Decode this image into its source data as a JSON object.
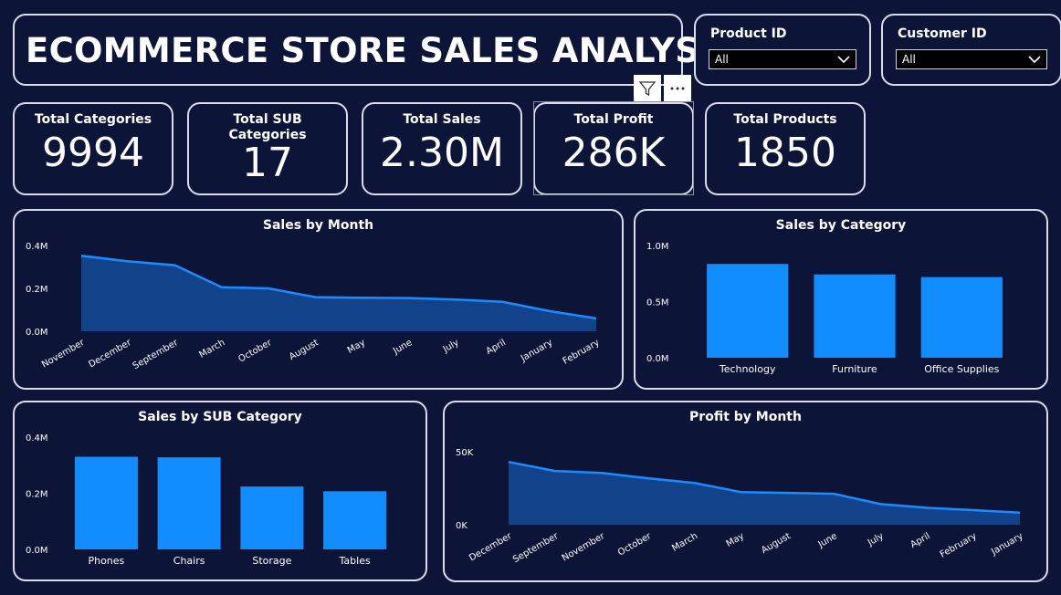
{
  "title": "ECOMMERCE STORE SALES ANALYSIS",
  "slicers": [
    {
      "label": "Product ID",
      "value": "All"
    },
    {
      "label": "Customer ID",
      "value": "All"
    }
  ],
  "kpis": [
    {
      "label": "Total Categories",
      "value": "9994"
    },
    {
      "label": "Total SUB Categories",
      "value": "17"
    },
    {
      "label": "Total Sales",
      "value": "2.30M"
    },
    {
      "label": "Total Profit",
      "value": "286K"
    },
    {
      "label": "Total Products",
      "value": "1850"
    }
  ],
  "toolbar": {
    "filter_icon": "filter-icon",
    "more_icon": "more-options-icon"
  },
  "colors": {
    "background": "#0c1538",
    "bar": "#118dff",
    "area_line": "#1a8cff",
    "area_fill": "#12438a",
    "border": "#d9dcea"
  },
  "chart_data": [
    {
      "type": "area",
      "title": "Sales by Month",
      "categories": [
        "November",
        "December",
        "September",
        "March",
        "October",
        "August",
        "May",
        "June",
        "July",
        "April",
        "January",
        "February"
      ],
      "values": [
        352000,
        326000,
        308000,
        205000,
        200000,
        159000,
        156000,
        155000,
        148000,
        137000,
        94000,
        60000
      ],
      "yticks": [
        "0.0M",
        "0.2M",
        "0.4M"
      ],
      "ylim": [
        0,
        400000
      ]
    },
    {
      "type": "bar",
      "title": "Sales by Category",
      "categories": [
        "Technology",
        "Furniture",
        "Office Supplies"
      ],
      "values": [
        836000,
        742000,
        719000
      ],
      "yticks": [
        "0.0M",
        "0.5M",
        "1.0M"
      ],
      "ylim": [
        0,
        1000000
      ]
    },
    {
      "type": "bar",
      "title": "Sales by SUB Category",
      "categories": [
        "Phones",
        "Chairs",
        "Storage",
        "Tables"
      ],
      "values": [
        330000,
        328000,
        224000,
        207000
      ],
      "yticks": [
        "0.0M",
        "0.2M",
        "0.4M"
      ],
      "ylim": [
        0,
        400000
      ]
    },
    {
      "type": "area",
      "title": "Profit by Month",
      "categories": [
        "December",
        "September",
        "November",
        "October",
        "March",
        "May",
        "August",
        "June",
        "July",
        "April",
        "February",
        "January"
      ],
      "values": [
        43000,
        36800,
        35500,
        31800,
        28600,
        22400,
        21800,
        21200,
        14100,
        11600,
        10000,
        8300
      ],
      "yticks": [
        "0K",
        "50K"
      ],
      "ylim": [
        0,
        50000
      ]
    }
  ]
}
